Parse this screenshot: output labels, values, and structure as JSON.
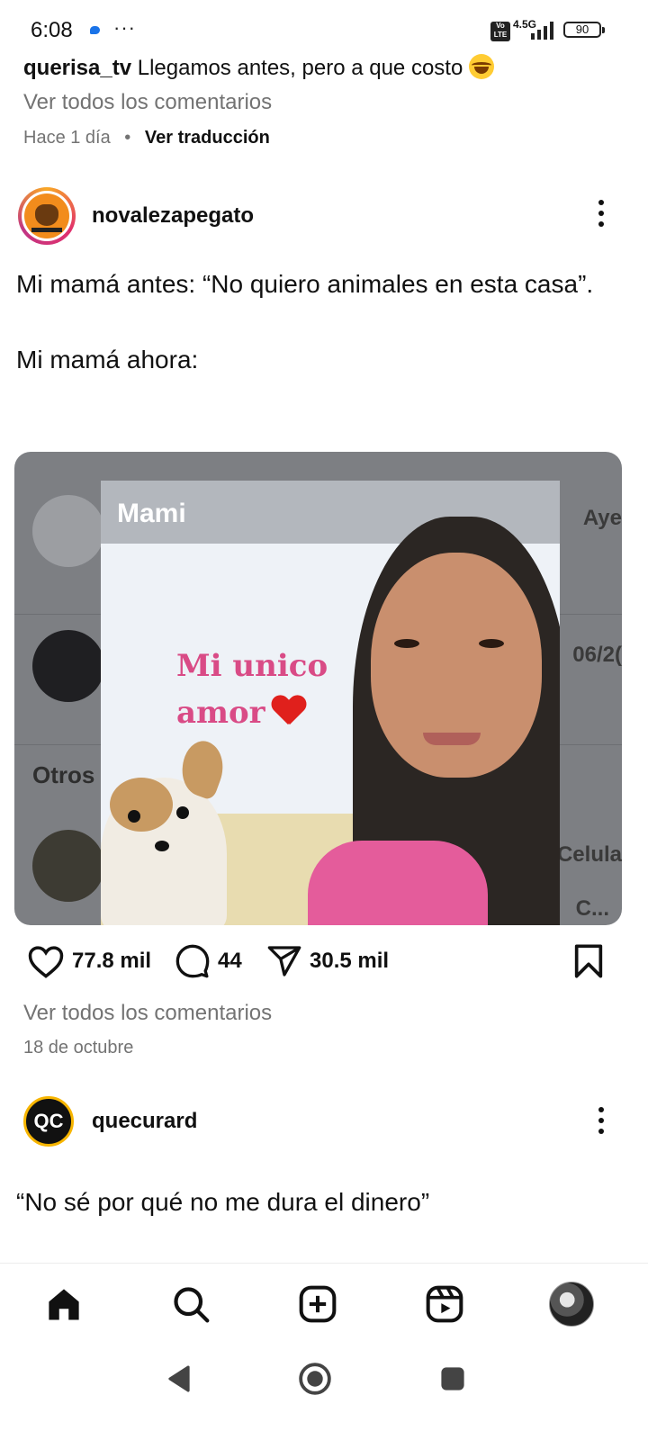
{
  "status_bar": {
    "time": "6:08",
    "more": "···",
    "volte": "Vo LTE",
    "network": "4.5G",
    "battery": "90"
  },
  "previous_post": {
    "comment_user": "querisa_tv",
    "comment_text": "Llegamos antes, pero a que costo",
    "view_all_comments": "Ver todos los comentarios",
    "time_ago": "Hace 1 día",
    "separator": "•",
    "translate": "Ver traducción"
  },
  "post": {
    "username": "novalezapegato",
    "caption_line1": "Mi mamá antes: “No quiero animales en esta casa”.",
    "caption_line2": "Mi mamá ahora:",
    "image": {
      "contact_name": "Mami",
      "overlay_text_line1": "Mi unico",
      "overlay_text_line2": "amor",
      "bg_label_otros": "Otros",
      "bg_right_1": "Aye",
      "bg_right_2": "06/2(",
      "bg_right_3": "Celula",
      "bg_right_4": "C..."
    },
    "likes": "77.8 mil",
    "comments": "44",
    "shares": "30.5 mil",
    "view_all_comments": "Ver todos los comentarios",
    "date": "18 de octubre"
  },
  "next_post": {
    "username": "quecurard",
    "avatar_text": "QC",
    "caption": "“No sé por qué no me dura el dinero”"
  },
  "bottom_nav": {
    "items": [
      "home-icon",
      "search-icon",
      "add-post-icon",
      "reels-icon",
      "profile-avatar"
    ]
  },
  "system_nav": {
    "items": [
      "back-icon",
      "home-circle-icon",
      "recents-icon"
    ]
  },
  "colors": {
    "text": "#111111",
    "muted": "#737373",
    "link_blue": "#1a73e8",
    "overlay_pink": "#d94b86",
    "heart_red": "#e0201c"
  }
}
